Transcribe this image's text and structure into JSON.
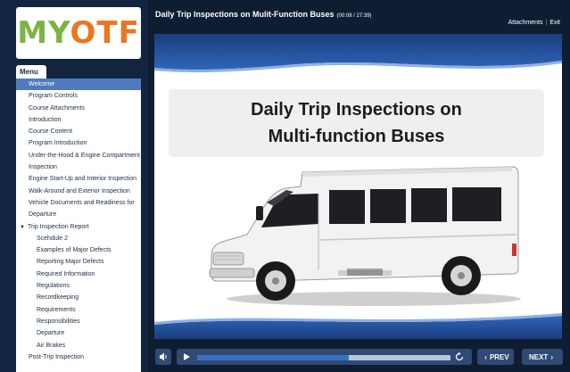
{
  "logo": {
    "text_m": "M",
    "text_y": "Y",
    "text_otf": "OTF"
  },
  "sidebar": {
    "menu_tab_label": "Menu",
    "items": [
      {
        "label": "Welcome",
        "active": true
      },
      {
        "label": "Program Controls"
      },
      {
        "label": "Course Attachments"
      },
      {
        "label": "Introduction"
      },
      {
        "label": "Course Content"
      },
      {
        "label": "Program Introduction"
      },
      {
        "label": "Under-the-Hood & Engine Compartment Inspection"
      },
      {
        "label": "Engine Start-Up and Interior Inspection"
      },
      {
        "label": "Walk-Around and Exterior Inspection"
      },
      {
        "label": "Vehicle Documents and Readiness for Departure"
      },
      {
        "label": "Trip Inspection Report",
        "expanded": true
      },
      {
        "label": "Scehdule 2"
      },
      {
        "label": "Examples of Major Defects"
      },
      {
        "label": "Reporting Major Defects"
      },
      {
        "label": "Required Information"
      },
      {
        "label": "Regulations"
      },
      {
        "label": "Recordkeeping"
      },
      {
        "label": "Requirements"
      },
      {
        "label": "Responsibilities"
      },
      {
        "label": "Departure"
      },
      {
        "label": "Air Brakes"
      },
      {
        "label": "Post-Trip Inspection"
      }
    ]
  },
  "header": {
    "title": "Daily Trip Inspections on Mulit-Function Buses",
    "time": "(00:08 / 27:39)",
    "attachments_label": "Attachments",
    "separator": "|",
    "exit_label": "Exit"
  },
  "slide": {
    "title_line1": "Daily Trip Inspections on",
    "title_line2": "Multi-function Buses",
    "image_icon": "bus-image"
  },
  "controls": {
    "progress": 0.6,
    "prev_label": "PREV",
    "next_label": "NEXT",
    "mute_icon": "speaker-icon",
    "play_icon": "play-icon",
    "replay_icon": "replay-icon"
  },
  "colors": {
    "background": "#0f1d33",
    "accent_blue": "#2f4a74",
    "active_menu": "#4f7bbd",
    "logo_green": "#7cb342",
    "logo_orange": "#e87722"
  }
}
